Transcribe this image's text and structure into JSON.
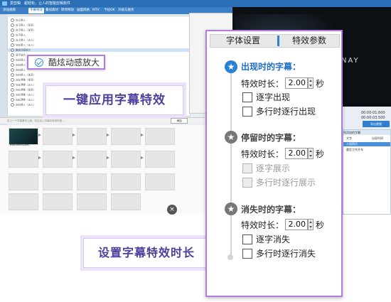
{
  "app": {
    "title": "爱剪辑　超轻松，让人的智能剪辑软件",
    "menu": [
      "添加视频",
      "字幕特效",
      "叠加素材",
      "转场特效",
      "画面风格",
      "MTV",
      "卡拉OK",
      "升级与服务"
    ],
    "active_menu_index": 1
  },
  "list": {
    "rows": [
      "向上移入",
      "向下移入（渐变）",
      "向下移入（渐变）",
      "向下移入",
      "向上移入（淡入）",
      "向左移入（淡入）",
      "酷炫动感放大",
      "逐字放大",
      "向左移入（淡入）",
      "向左移入",
      "向右移入",
      "向右移入（渐变）",
      "向左漂移（渐变）",
      "向左漂移（淡入）",
      "向右漂移（渐变）",
      "向右漂移（淡入）",
      "向右漂移（淡入）",
      "向右移入（淡入）"
    ],
    "selected_index": 6
  },
  "callout": {
    "label": "酷炫动感放大"
  },
  "banners": {
    "top": "一键应用字幕特效",
    "bottom": "设置字幕特效时长"
  },
  "media": {
    "hint": "在上一个字幕素材上面，双击加入字幕特效或叫做...",
    "import_label": "添加",
    "thumb_caption": "BestSeoulLight..."
  },
  "video": {
    "overlay_text": "NAY",
    "time1": "00:00:01.600",
    "time2": "00:00:03.500"
  },
  "export": {
    "label": "导出视频"
  },
  "subtitles": {
    "title": "所添加的字幕",
    "col_text": "文字",
    "col_time": "出现时间",
    "rows": [
      "人间四月",
      "重型工作开车"
    ]
  },
  "effects_panel": {
    "tabs": [
      "字体设置",
      "特效参数"
    ],
    "active_tab_index": 1,
    "sections": [
      {
        "title": "出现时的字幕：",
        "icon": "star-arrow-icon",
        "active": true,
        "duration_label": "特效时长：",
        "duration": "2.00",
        "unit": "秒",
        "options": [
          {
            "label": "逐字出现",
            "enabled": true,
            "checked": false
          },
          {
            "label": "多行时逐行出现",
            "enabled": true,
            "checked": false
          }
        ]
      },
      {
        "title": "停留时的字幕：",
        "icon": "star-icon",
        "active": false,
        "duration_label": "特效时长：",
        "duration": "2.00",
        "unit": "秒",
        "options": [
          {
            "label": "逐字展示",
            "enabled": false,
            "checked": false
          },
          {
            "label": "多行时逐行展示",
            "enabled": false,
            "checked": false
          }
        ]
      },
      {
        "title": "消失时的字幕：",
        "icon": "star-arrow-icon",
        "active": false,
        "duration_label": "特效时长：",
        "duration": "2.00",
        "unit": "秒",
        "options": [
          {
            "label": "逐字消失",
            "enabled": true,
            "checked": false
          },
          {
            "label": "多行时逐行消失",
            "enabled": true,
            "checked": false
          }
        ]
      }
    ]
  },
  "colors": {
    "accent": "#2a7fd6",
    "callout_border": "#b07ce0",
    "banner_text": "#4b3f9a"
  }
}
